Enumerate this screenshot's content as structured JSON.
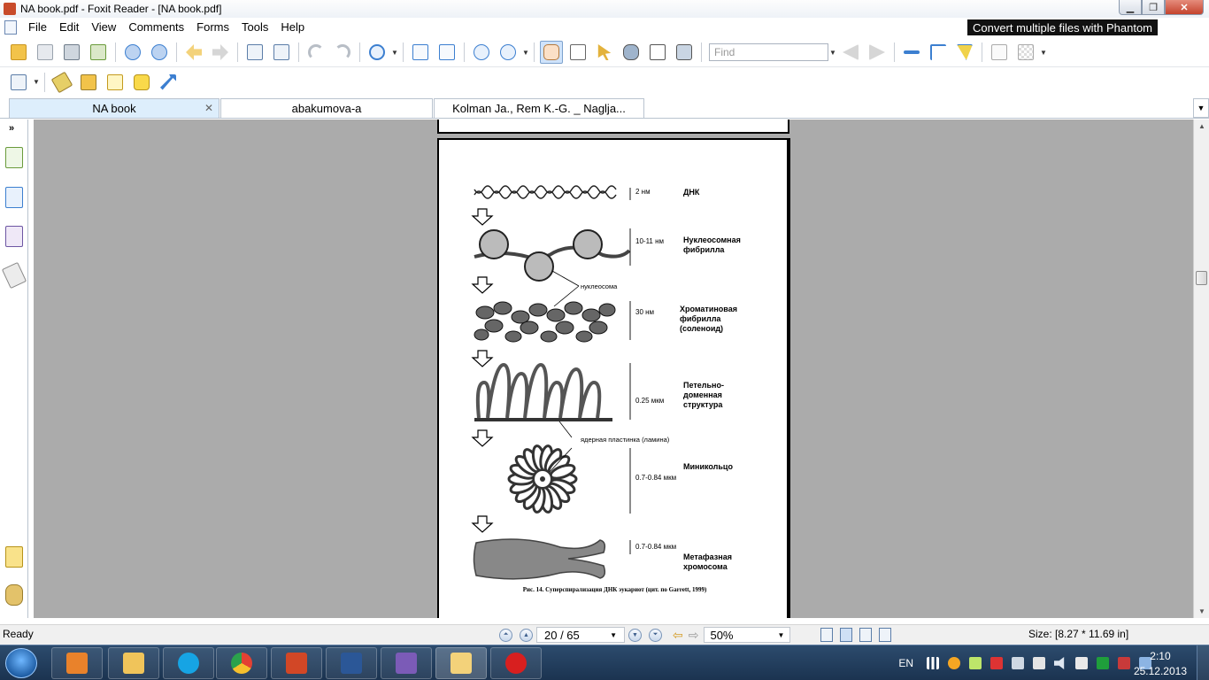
{
  "window": {
    "title": "NA book.pdf - Foxit Reader - [NA book.pdf]",
    "min_label": "▁",
    "max_label": "❐",
    "close_label": "✕"
  },
  "menu": {
    "items": [
      "File",
      "Edit",
      "View",
      "Comments",
      "Forms",
      "Tools",
      "Help"
    ],
    "promo": "Convert multiple files with Phantom"
  },
  "toolbar": {
    "find_placeholder": "Find"
  },
  "tabs": [
    {
      "label": "NA book",
      "active": true
    },
    {
      "label": "abakumova-a",
      "active": false
    },
    {
      "label": "Kolman Ja., Rem K.-G. _ Naglja...",
      "active": false
    }
  ],
  "figure": {
    "labels": {
      "dna": "ДНК",
      "nucleosome_fibril": "Нуклеосомная фибрилла",
      "chromatin_fibril": "Хроматиновая фибрилла (соленоид)",
      "loop_domain": "Петельно-доменная структура",
      "miniring": "Миникольцо",
      "metaphase": "Метафазная хромосома"
    },
    "measures": {
      "dna": "2 нм",
      "nucleosome": "10-11 нм",
      "chromatin": "30 нм",
      "loop": "0.25 мкм",
      "miniring": "0.7-0.84 мкм",
      "metaphase": "0.7-0.84 мкм"
    },
    "notes": {
      "nucleosome": "нуклеосома",
      "lamina": "ядерная пластинка (ламина)"
    },
    "caption": "Рис. 14. Суперспирализация ДНК эукариот (цит. по Garrett, 1999)"
  },
  "status": {
    "text": "Ready",
    "page": "20 / 65",
    "zoom": "50%",
    "size": "Size: [8.27 * 11.69 in]"
  },
  "taskbar": {
    "lang": "EN",
    "time": "2:10",
    "date": "25.12.2013"
  },
  "colors": {
    "accent": "#3c7fd0",
    "docarea": "#ababab",
    "taskbar": "#1b3350"
  }
}
